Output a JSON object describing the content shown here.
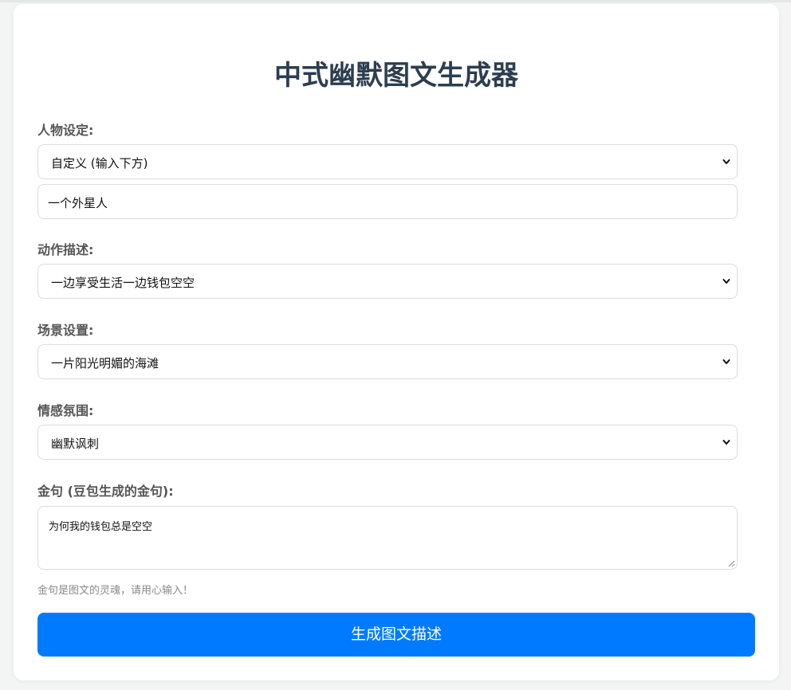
{
  "title": "中式幽默图文生成器",
  "character": {
    "label": "人物设定:",
    "selected": "自定义 (输入下方)",
    "custom_value": "一个外星人"
  },
  "action": {
    "label": "动作描述:",
    "selected": "一边享受生活一边钱包空空"
  },
  "scene": {
    "label": "场景设置:",
    "selected": "一片阳光明媚的海滩"
  },
  "emotion": {
    "label": "情感氛围:",
    "selected": "幽默讽刺"
  },
  "quote": {
    "label": "金句 (豆包生成的金句):",
    "value": "为何我的钱包总是空空",
    "hint": "金句是图文的灵魂，请用心输入！"
  },
  "generate_button": "生成图文描述",
  "colors": {
    "accent": "#007bff",
    "title": "#2c3e50",
    "label": "#555555",
    "hint": "#8a8a8a",
    "background": "#f3f4f4"
  },
  "icons": [
    "chevron-down-icon",
    "resize-grip-icon"
  ]
}
